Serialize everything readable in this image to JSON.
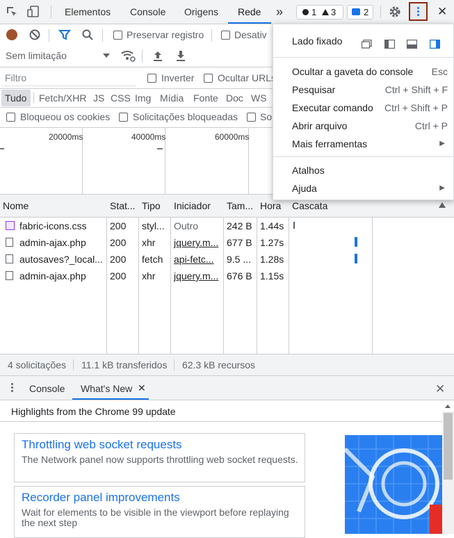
{
  "toolbar": {
    "tabs": [
      "Elementos",
      "Console",
      "Origens",
      "Rede"
    ],
    "more_tabs": "»",
    "errors_count": "1",
    "warnings_count": "3",
    "messages_count": "2",
    "close": "✕"
  },
  "network_toolbar": {
    "preserve_log": "Preservar registro",
    "disable_cache": "Desativ",
    "throttling": "Sem limitação"
  },
  "filter": {
    "placeholder": "Filtro",
    "invert": "Inverter",
    "hide_urls": "Ocultar URLs"
  },
  "type_filters": [
    "Tudo",
    "Fetch/XHR",
    "JS",
    "CSS",
    "Img",
    "Mídia",
    "Fonte",
    "Doc",
    "WS"
  ],
  "block_filters": {
    "blocked_cookies": "Bloqueou os cookies",
    "blocked_requests": "Solicitações bloqueadas",
    "third": "So"
  },
  "timeline": {
    "ticks": [
      "20000ms",
      "40000ms",
      "60000ms"
    ]
  },
  "table": {
    "headers": {
      "name": "Nome",
      "status": "Stat...",
      "type": "Tipo",
      "initiator": "Iniciador",
      "size": "Tam...",
      "time": "Hora",
      "waterfall": "Cascata"
    },
    "rows": [
      {
        "name": "fabric-icons.css",
        "status": "200",
        "type": "styl...",
        "initiator": "Outro",
        "size": "242 B",
        "time": "1.44s"
      },
      {
        "name": "admin-ajax.php",
        "status": "200",
        "type": "xhr",
        "initiator": "jquery.m...",
        "size": "677 B",
        "time": "1.27s"
      },
      {
        "name": "autosaves?_local...",
        "status": "200",
        "type": "fetch",
        "initiator": "api-fetc...",
        "size": "9.5 ...",
        "time": "1.28s"
      },
      {
        "name": "admin-ajax.php",
        "status": "200",
        "type": "xhr",
        "initiator": "jquery.m...",
        "size": "676 B",
        "time": "1.15s"
      }
    ]
  },
  "status_bar": {
    "requests": "4 solicitações",
    "transferred": "11.1 kB transferidos",
    "resources": "62.3 kB recursos"
  },
  "drawer": {
    "tabs": [
      "Console",
      "What's New"
    ],
    "tab_close": "✕",
    "close": "✕",
    "highlights": "Highlights from the Chrome 99 update",
    "cards": [
      {
        "title": "Throttling web socket requests",
        "desc": "The Network panel now supports throttling web socket requests."
      },
      {
        "title": "Recorder panel improvements",
        "desc": "Wait for elements to be visible in the viewport before replaying the next step"
      }
    ]
  },
  "menu": {
    "dock_side": "Lado fixado",
    "items": [
      {
        "label": "Ocultar a gaveta do console",
        "key": "Esc"
      },
      {
        "label": "Pesquisar",
        "key": "Ctrl + Shift + F"
      },
      {
        "label": "Executar comando",
        "key": "Ctrl + Shift + P"
      },
      {
        "label": "Abrir arquivo",
        "key": "Ctrl + P"
      },
      {
        "label": "Mais ferramentas",
        "arrow": "▶"
      },
      {
        "label": "Atalhos"
      },
      {
        "label": "Ajuda",
        "arrow": "▶"
      }
    ]
  },
  "colors": {
    "accent": "#1a73e8",
    "record": "#c5221f",
    "highlight_border": "#8b2a0f"
  }
}
